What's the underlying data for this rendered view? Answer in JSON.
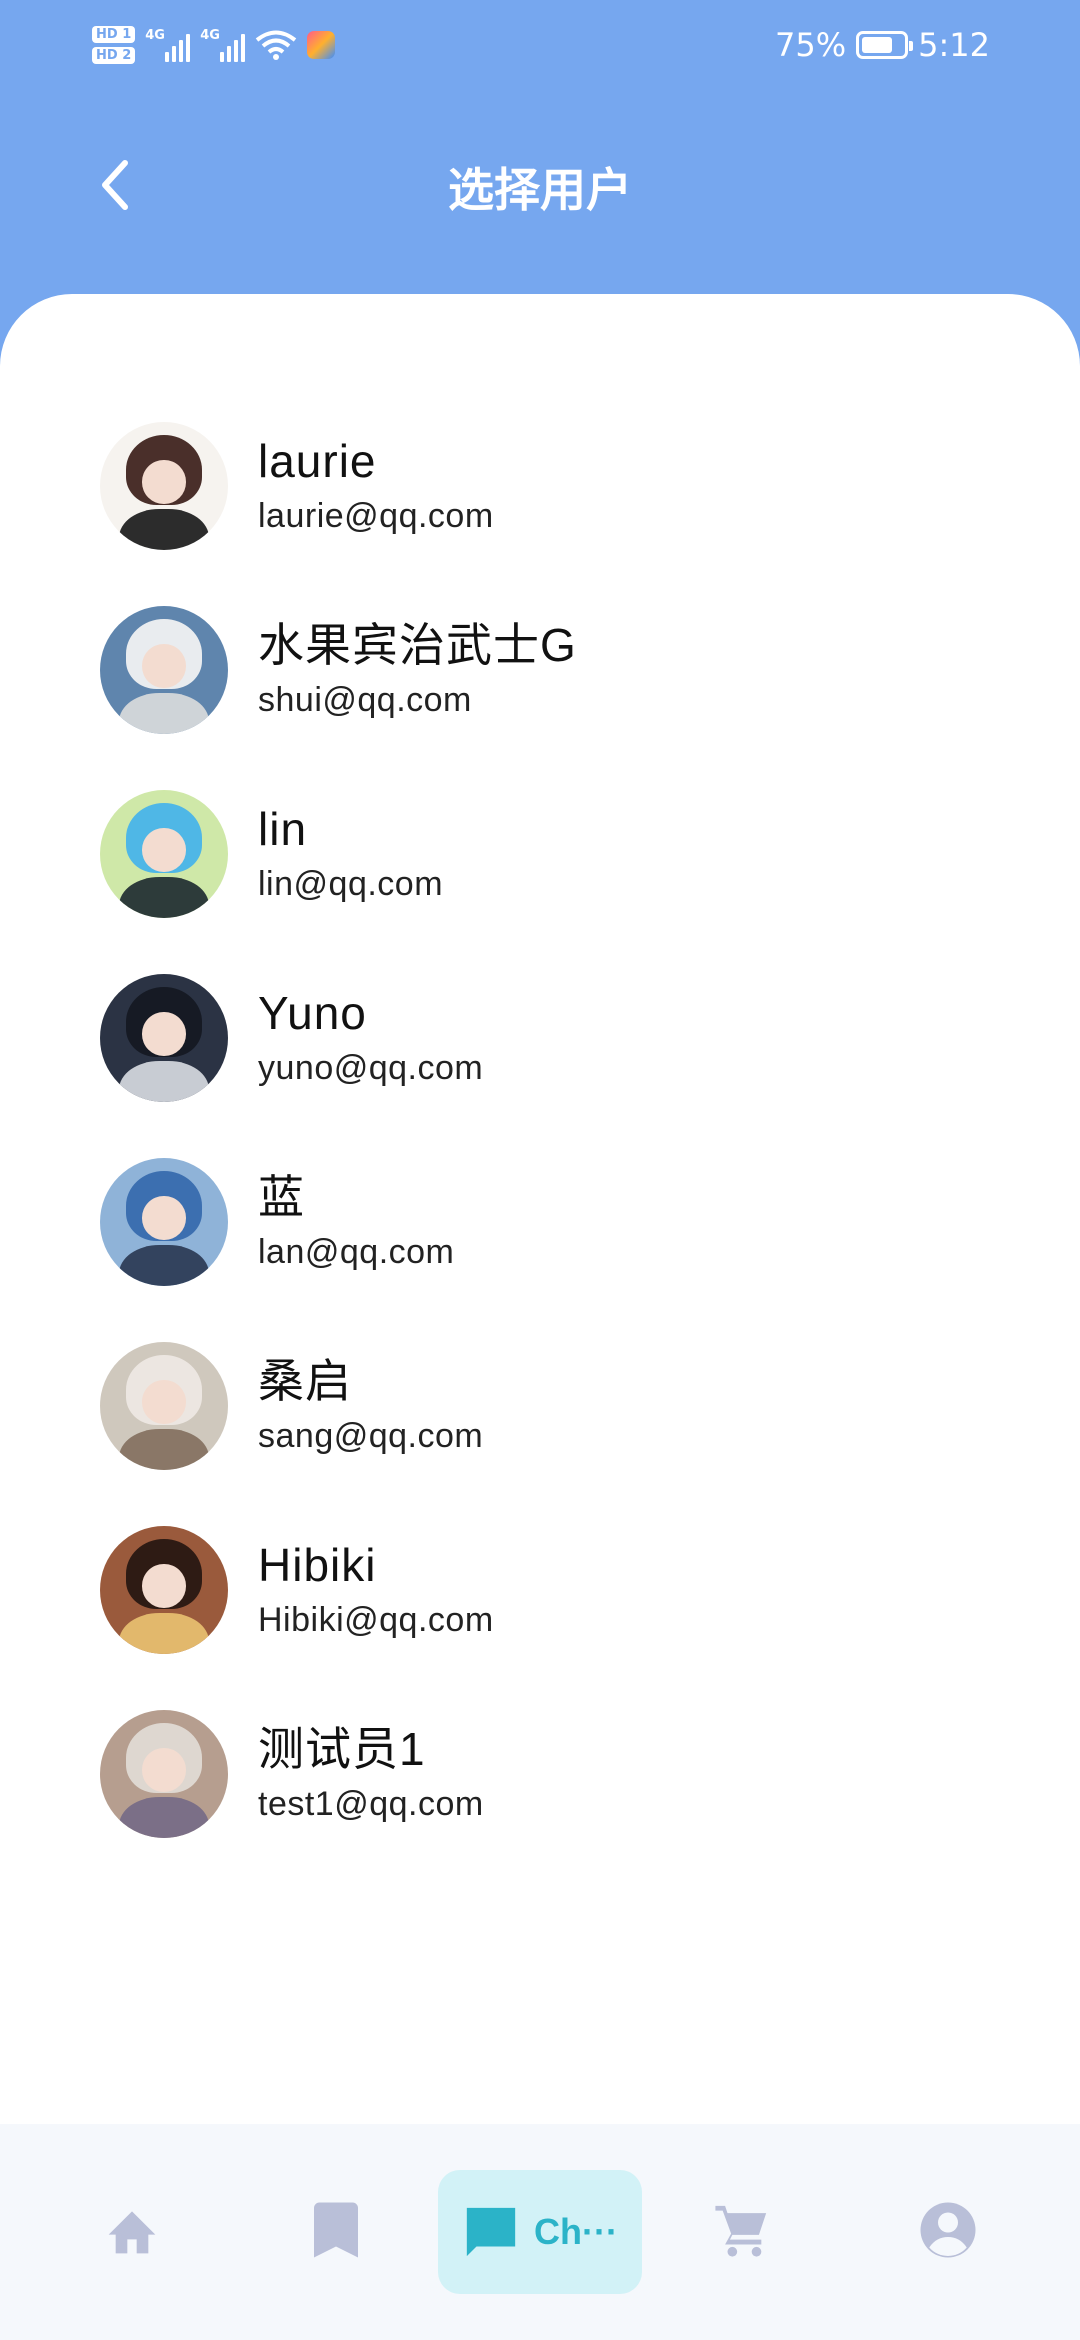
{
  "status_bar": {
    "hd1": "HD 1",
    "hd2": "HD 2",
    "net1": "4G",
    "net2": "4G",
    "battery": "75%",
    "time": "5:12"
  },
  "header": {
    "title": "选择用户",
    "back_icon": "chevron-left-icon"
  },
  "users": [
    {
      "name": "laurie",
      "email": "laurie@qq.com"
    },
    {
      "name": "水果宾治武士G",
      "email": "shui@qq.com"
    },
    {
      "name": "lin",
      "email": "lin@qq.com"
    },
    {
      "name": "Yuno",
      "email": "yuno@qq.com"
    },
    {
      "name": "蓝",
      "email": "lan@qq.com"
    },
    {
      "name": "桑启",
      "email": "sang@qq.com"
    },
    {
      "name": "Hibiki",
      "email": "Hibiki@qq.com"
    },
    {
      "name": "测试员1",
      "email": "test1@qq.com"
    }
  ],
  "bottom_nav": {
    "items": [
      {
        "icon": "home-icon"
      },
      {
        "icon": "bookmark-icon"
      },
      {
        "icon": "chat-icon",
        "label": "Ch···",
        "active": true
      },
      {
        "icon": "cart-icon"
      },
      {
        "icon": "account-icon"
      }
    ],
    "active_color": "#2bb3c8",
    "inactive_color": "#b9bfd8"
  },
  "colors": {
    "header_bg": "#76a7ef",
    "sheet_bg": "#ffffff",
    "nav_active_bg": "#d2f2f7"
  }
}
